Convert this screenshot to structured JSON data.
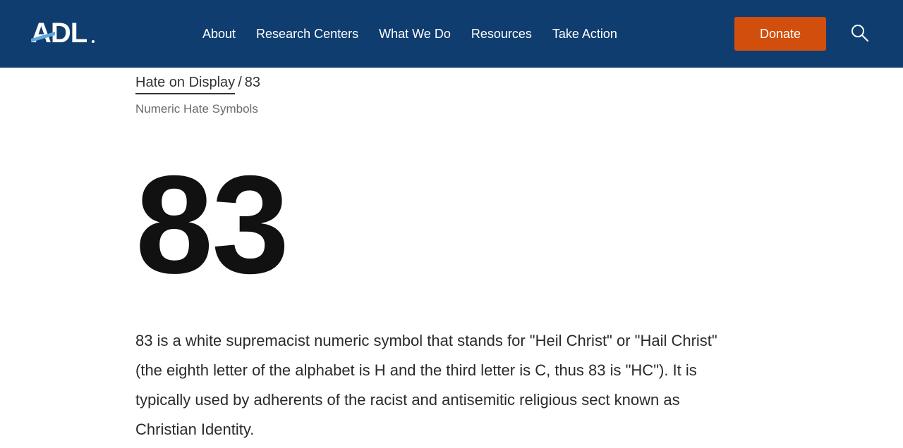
{
  "header": {
    "logo_text": "ADL",
    "nav": [
      "About",
      "Research Centers",
      "What We Do",
      "Resources",
      "Take Action"
    ],
    "donate_label": "Donate",
    "colors": {
      "background": "#0f3d70",
      "donate": "#d24e0c",
      "text": "#ffffff"
    }
  },
  "breadcrumb": {
    "parent": "Hate on Display",
    "separator": "/",
    "current": "83"
  },
  "category": "Numeric Hate Symbols",
  "symbol": "83",
  "description": "83 is a white supremacist numeric symbol that stands for \"Heil Christ\" or \"Hail Christ\" (the eighth letter of the alphabet is H and the third letter is C, thus 83 is \"HC\"). It is typically used by adherents of the racist and antisemitic religious sect known as Christian Identity.",
  "icons": {
    "search": "search-icon",
    "logo": "adl-logo"
  }
}
